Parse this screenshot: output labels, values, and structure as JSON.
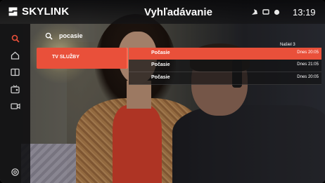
{
  "header": {
    "brand": "SKYLINK",
    "title": "Vyhľadávanie",
    "clock": "13:19",
    "status_icons": [
      "signal-icon",
      "record-icon",
      "dot-icon"
    ]
  },
  "rail": {
    "items": [
      {
        "name": "search-icon",
        "active": true
      },
      {
        "name": "home-icon",
        "active": false
      },
      {
        "name": "book-icon",
        "active": false
      },
      {
        "name": "tv-icon",
        "active": false
      },
      {
        "name": "camera-icon",
        "active": false
      },
      {
        "name": "settings-icon",
        "active": false
      }
    ]
  },
  "search": {
    "query": "pocasie",
    "results_count": "Našiel 3"
  },
  "category": {
    "label": "TV SLUŽBY"
  },
  "results": [
    {
      "title": "Počasie",
      "time": "Dnes 20:05",
      "active": true
    },
    {
      "title": "Počasie",
      "time": "Dnes 21:05",
      "active": false
    },
    {
      "title": "Počasie",
      "time": "Dnes 20:05",
      "active": false
    }
  ],
  "colors": {
    "accent": "#e9503a",
    "text": "#ffffff"
  }
}
